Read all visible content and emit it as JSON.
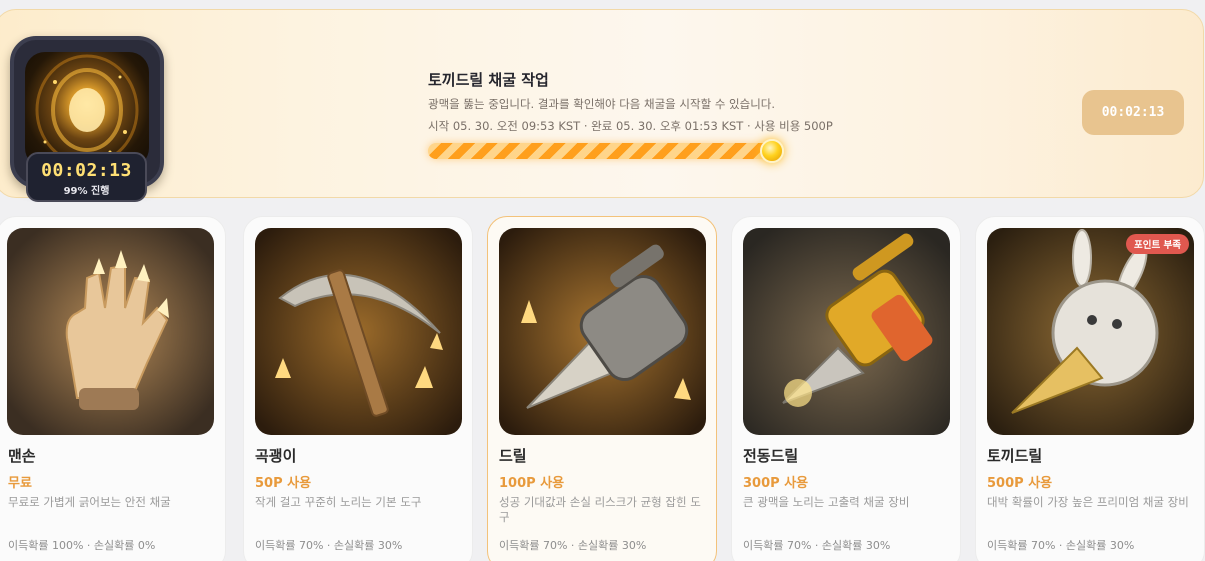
{
  "mining": {
    "timer_overlay": "00:02:13",
    "progress_text": "99% 진행",
    "title": "토끼드릴 채굴 작업",
    "description": "광맥을 뚫는 중입니다. 결과를 확인해야 다음 채굴을 시작할 수 있습니다.",
    "meta": "시작 05. 30. 오전 09:53 KST · 완료 05. 30. 오후 01:53 KST · 사용 비용 500P",
    "progress_percent": 99,
    "timer_button": "00:02:13"
  },
  "tools": [
    {
      "name": "맨손",
      "cost": "무료",
      "description": "무료로 가볍게 긁어보는 안전 채굴",
      "odds": "이득확률 100% · 손실확률 0%",
      "image_icon": "glove-icon"
    },
    {
      "name": "곡괭이",
      "cost": "50P 사용",
      "description": "작게 걸고 꾸준히 노리는 기본 도구",
      "odds": "이득확률 70% · 손실확률 30%",
      "image_icon": "pickaxe-icon"
    },
    {
      "name": "드릴",
      "cost": "100P 사용",
      "description": "성공 기대값과 손실 리스크가 균형 잡힌 도구",
      "odds": "이득확률 70% · 손실확률 30%",
      "image_icon": "drill-icon",
      "selected": true
    },
    {
      "name": "전동드릴",
      "cost": "300P 사용",
      "description": "큰 광맥을 노리는 고출력 채굴 장비",
      "odds": "이득확률 70% · 손실확률 30%",
      "image_icon": "power-drill-icon"
    },
    {
      "name": "토끼드릴",
      "cost": "500P 사용",
      "description": "대박 확률이 가장 높은 프리미엄 채굴 장비",
      "odds": "이득확률 70% · 손실확률 30%",
      "image_icon": "rabbit-drill-icon",
      "badge": "포인트 부족"
    }
  ],
  "colors": {
    "accent": "#e89a3c",
    "badge": "#e0584f",
    "timer_button_bg": "#e8c48f"
  }
}
